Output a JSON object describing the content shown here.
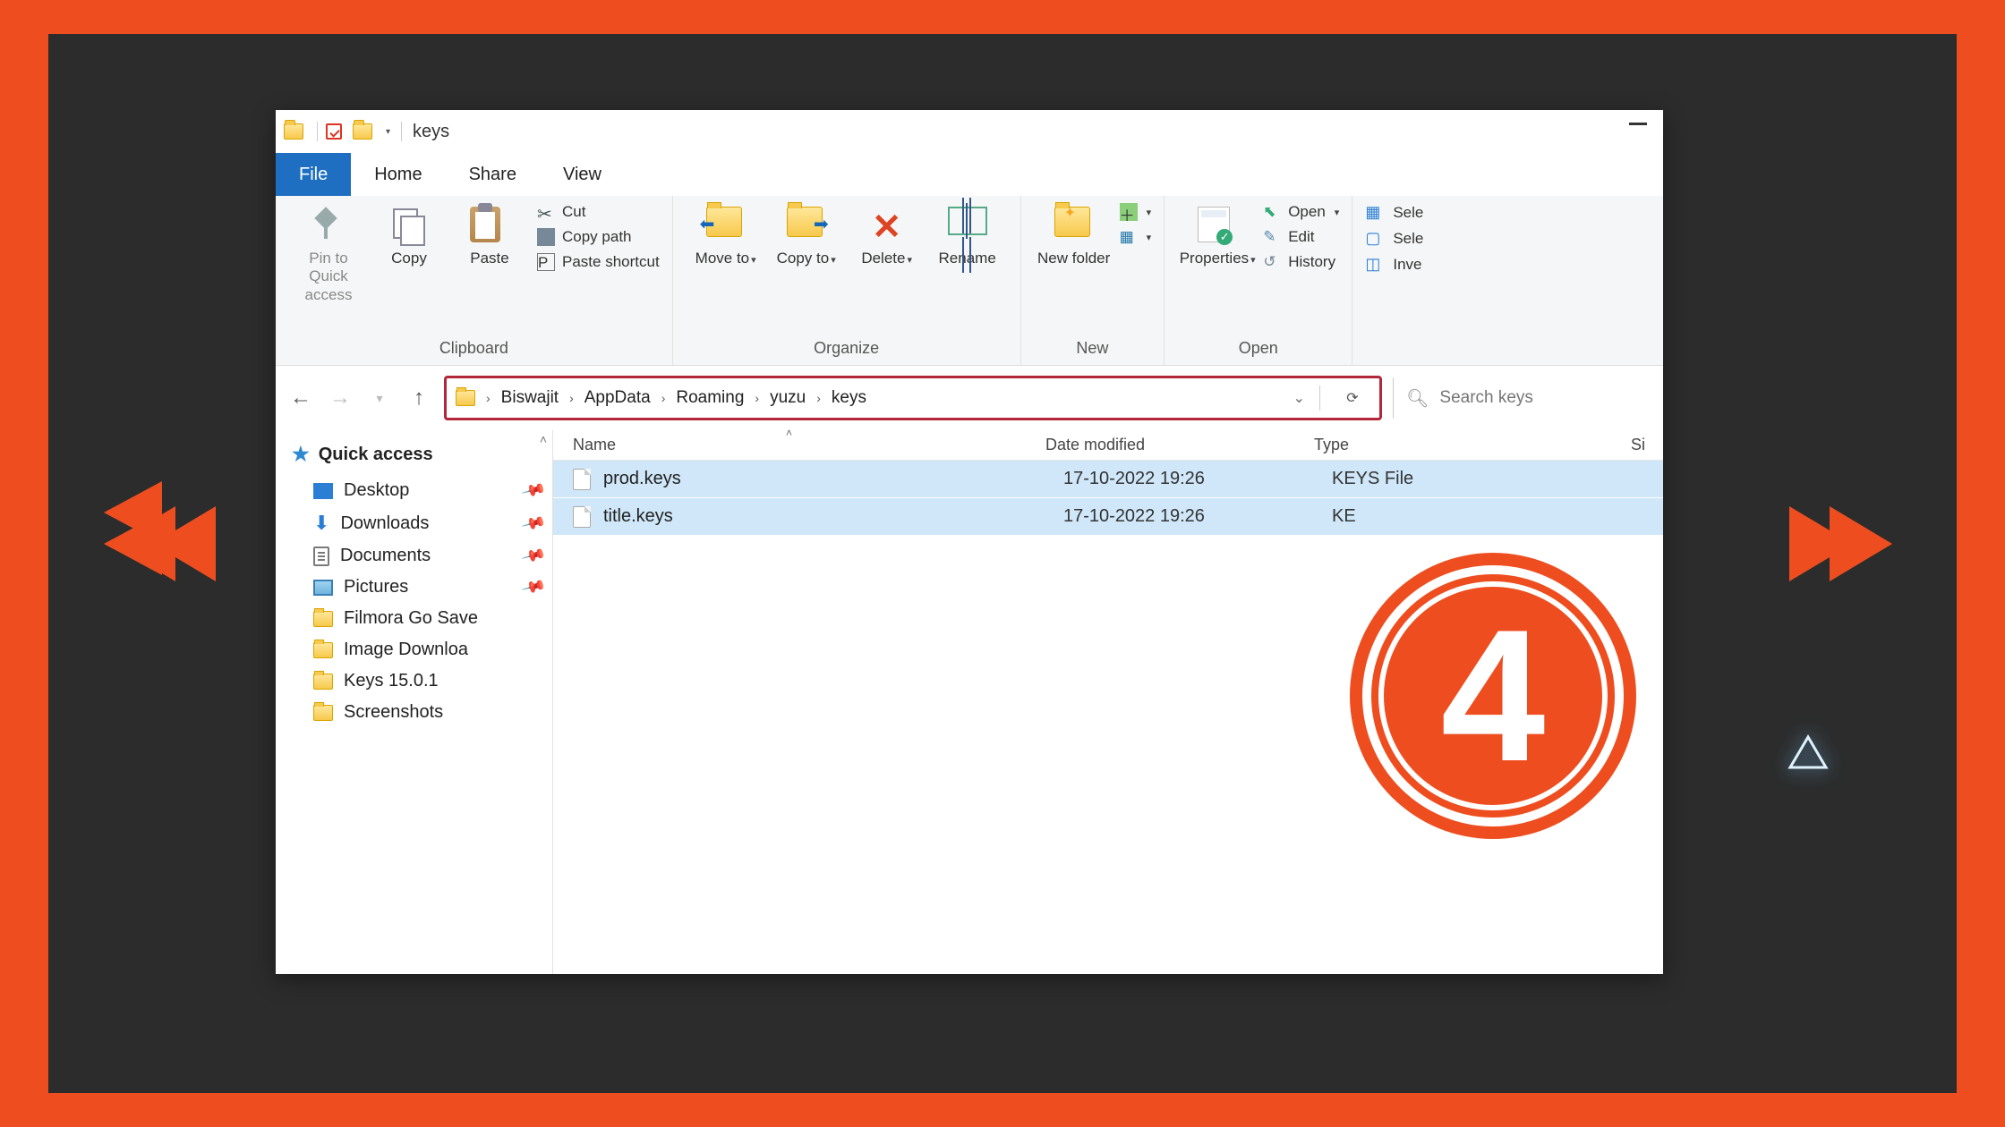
{
  "overlay": {
    "step_number": "4"
  },
  "titlebar": {
    "title": "keys"
  },
  "tabs": {
    "file": "File",
    "home": "Home",
    "share": "Share",
    "view": "View"
  },
  "ribbon": {
    "clipboard": {
      "caption": "Clipboard",
      "pin": "Pin to Quick access",
      "copy": "Copy",
      "paste": "Paste",
      "cut": "Cut",
      "copypath": "Copy path",
      "pasteshortcut": "Paste shortcut"
    },
    "organize": {
      "caption": "Organize",
      "moveto": "Move to",
      "copyto": "Copy to",
      "delete": "Delete",
      "rename": "Rename"
    },
    "new": {
      "caption": "New",
      "newfolder": "New folder"
    },
    "open": {
      "caption": "Open",
      "properties": "Properties",
      "open": "Open",
      "edit": "Edit",
      "history": "History"
    },
    "select": {
      "all": "Sele",
      "none": "Sele",
      "invert": "Inve"
    }
  },
  "breadcrumb": {
    "parts": [
      "Biswajit",
      "AppData",
      "Roaming",
      "yuzu",
      "keys"
    ]
  },
  "search": {
    "placeholder": "Search keys"
  },
  "sidebar": {
    "quick": "Quick access",
    "items": [
      {
        "name": "Desktop",
        "icon": "desktop",
        "pinned": true
      },
      {
        "name": "Downloads",
        "icon": "downloads",
        "pinned": true
      },
      {
        "name": "Documents",
        "icon": "documents",
        "pinned": true
      },
      {
        "name": "Pictures",
        "icon": "pictures",
        "pinned": true
      },
      {
        "name": "Filmora Go Save",
        "icon": "folder",
        "pinned": false
      },
      {
        "name": "Image Downloa",
        "icon": "folder",
        "pinned": false
      },
      {
        "name": "Keys 15.0.1",
        "icon": "folder",
        "pinned": false
      },
      {
        "name": "Screenshots",
        "icon": "folder",
        "pinned": false
      }
    ]
  },
  "columns": {
    "name": "Name",
    "date": "Date modified",
    "type": "Type",
    "size": "Si"
  },
  "files": [
    {
      "name": "prod.keys",
      "date": "17-10-2022 19:26",
      "type": "KEYS File"
    },
    {
      "name": "title.keys",
      "date": "17-10-2022 19:26",
      "type": "KE"
    }
  ]
}
